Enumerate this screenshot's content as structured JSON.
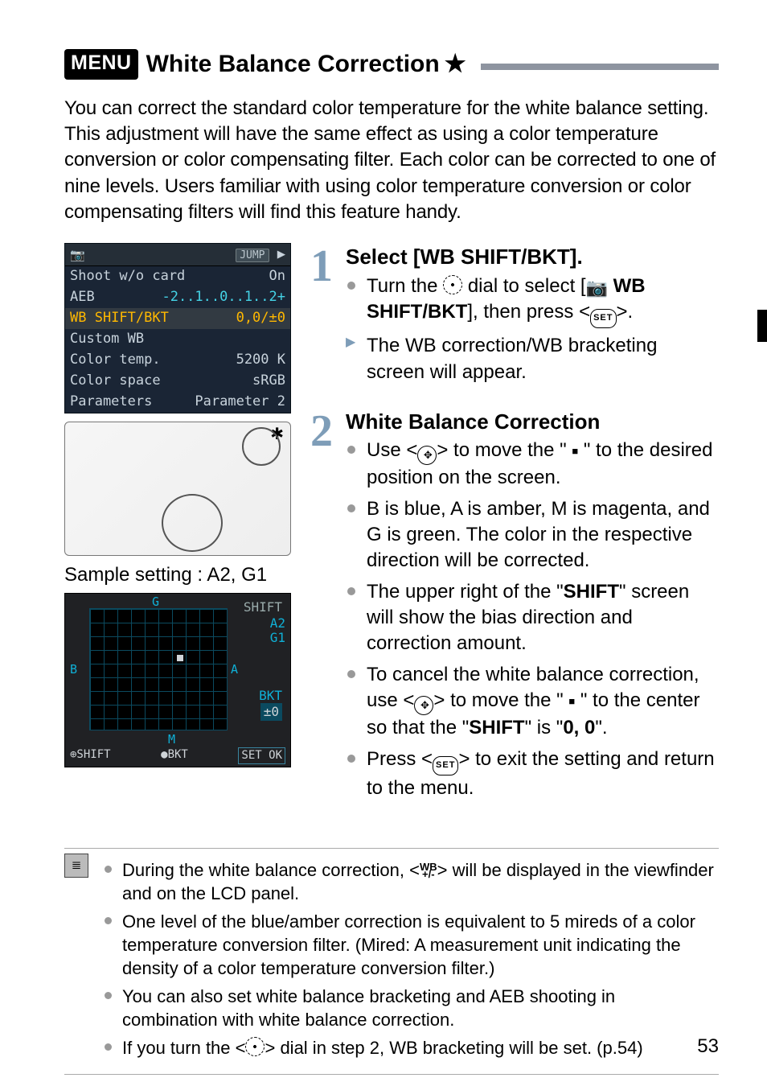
{
  "header": {
    "menu_badge": "MENU",
    "title": "White Balance Correction",
    "star": "★"
  },
  "intro": "You can correct the standard color temperature for the white balance setting. This adjustment will have the same effect as using a color temperature conversion or color compensating filter. Each color can be corrected to one of nine levels. Users familiar with using color temperature conversion or color compensating filters will find this feature handy.",
  "lcd": {
    "top": {
      "cam": "📷",
      "jump": "JUMP",
      "arrow": "▶"
    },
    "rows": [
      {
        "label": "Shoot w/o card",
        "value": "On",
        "cls": ""
      },
      {
        "label": "AEB",
        "value": "-2..1..0..1..2+",
        "cls": "cyan"
      },
      {
        "label": "WB SHIFT/BKT",
        "value": "0,0/±0",
        "cls": "orange",
        "hi": true
      },
      {
        "label": "Custom WB",
        "value": "",
        "cls": ""
      },
      {
        "label": "Color temp.",
        "value": "5200 K",
        "cls": ""
      },
      {
        "label": "Color space",
        "value": "sRGB",
        "cls": ""
      },
      {
        "label": "Parameters",
        "value": "Parameter 2",
        "cls": ""
      }
    ]
  },
  "caption": "Sample setting : A2, G1",
  "wbshot": {
    "g": "G",
    "b": "B",
    "a": "A",
    "m": "M",
    "shift": "SHIFT",
    "vals": [
      "A2",
      "G1"
    ],
    "bkt": "BKT",
    "bktval": "±0",
    "foot_left": "⊕SHIFT",
    "foot_mid": "●BKT",
    "foot_right": "SET OK"
  },
  "steps": [
    {
      "num": "1",
      "title": "Select [WB SHIFT/BKT].",
      "items": [
        {
          "type": "dot",
          "html": "Turn the <span class='glyph dial'></span> dial to select [<span class='cam-inline'>📷</span> <b>WB SHIFT/BKT</b>], then press <<span class='glyph set'>SET</span>>."
        },
        {
          "type": "arrow",
          "html": "The WB correction/WB bracketing screen will appear."
        }
      ]
    },
    {
      "num": "2",
      "title": "White Balance Correction",
      "items": [
        {
          "type": "dot",
          "html": "Use <<span class='glyph joy'>✥</span>> to move the \" <span class='black-sq'>■</span> \" to the desired position on the screen."
        },
        {
          "type": "dot",
          "html": "B is blue, A is amber, M is magenta, and G is green. The color in the respective direction will be corrected."
        },
        {
          "type": "dot",
          "html": "The upper right of the \"<b>SHIFT</b>\" screen will show the bias direction and correction amount."
        },
        {
          "type": "dot",
          "html": "To cancel the white balance correction, use <<span class='glyph joy'>✥</span>> to move the \" <span class='black-sq'>■</span> \" to the center so that the \"<b>SHIFT</b>\" is \"<b>0, 0</b>\"."
        },
        {
          "type": "dot",
          "html": "Press <<span class='glyph set'>SET</span>> to exit the setting and return to the menu."
        }
      ]
    }
  ],
  "notes": [
    "During the white balance correction, <<span class='wb-tiny'><span class='b'>WB</span>+/-</span>> will be displayed in the viewfinder and on the LCD panel.",
    "One level of the blue/amber correction is equivalent to 5 mireds of a color temperature conversion filter. (Mired: A measurement unit indicating the density of a color temperature conversion filter.)",
    "You can also set white balance bracketing and AEB shooting in combination with white balance correction.",
    "If you turn the <<span class='glyph dial'></span>> dial in step 2, WB bracketing will be set. (p.54)"
  ],
  "page_number": "53"
}
